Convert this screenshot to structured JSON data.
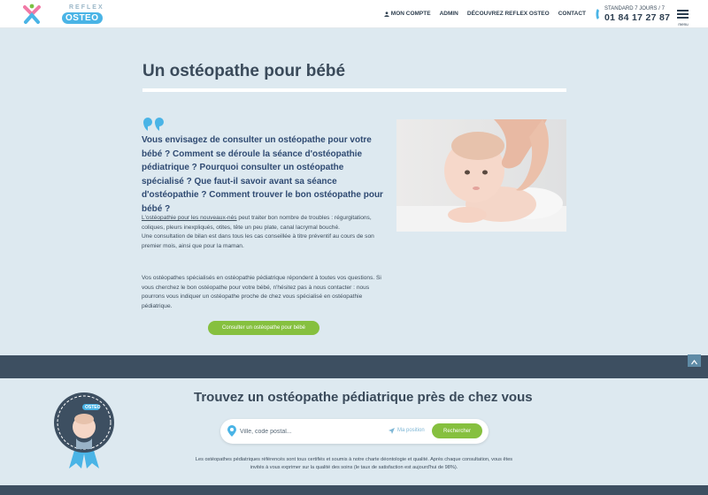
{
  "header": {
    "logo_small": "REFLEX",
    "logo_big": "OSTEO",
    "nav": [
      {
        "label": "MON COMPTE",
        "icon": "user-icon"
      },
      {
        "label": "ADMIN"
      },
      {
        "label": "DÉCOUVREZ REFLEX OSTEO"
      },
      {
        "label": "CONTACT"
      }
    ],
    "phone_sub": "STANDARD 7 JOURS / 7",
    "phone_number": "01 84 17 27 87",
    "menu_label": "menu"
  },
  "main": {
    "title": "Un ostéopathe pour bébé",
    "lead": "Vous envisagez de consulter un ostéopathe pour votre bébé ? Comment se déroule la séance d'ostéopathie pédiatrique ? Pourquoi consulter un ostéopathe spécialisé ? Que faut-il savoir avant sa séance d'ostéopathie ? Comment trouver le bon ostéopathe pour bébé ?",
    "link_text": "L'ostéopathie pour les nouveaux-nés",
    "para1_rest": " peut traiter bon nombre de troubles : régurgitations, coliques, pleurs inexpliqués, otites, tête un peu plate, canal lacrymal bouché.",
    "para1_line2": "Une consultation de bilan est dans tous les cas conseillée à titre préventif au cours de son premier mois, ainsi que pour la maman.",
    "para2": "Vos ostéopathes spécialisés en ostéopathie pédiatrique répondent à toutes vos questions. Si vous cherchez le bon ostéopathe pour votre bébé, n'hésitez pas à nous contacter : nous pourrons vous indiquer un ostéopathe proche de chez vous spécialisé en ostéopathie pédiatrique.",
    "cta_label": "Consulter un ostéopathe pour bébé"
  },
  "finder": {
    "title": "Trouvez un ostéopathe pédiatrique près de chez vous",
    "badge_text": "OSTEO",
    "search_placeholder": "Ville, code postal...",
    "my_position": "Ma position",
    "search_button": "Rechercher",
    "disclaimer": "Les ostéopathes pédiatriques référencés sont tous certifiés et soumis à notre charte déontologie et qualité. Après chaque consultation, vous êtes invités à vous exprimer sur la qualité des soins (le taux de satisfaction est aujourd'hui de 98%)."
  },
  "colors": {
    "accent_green": "#86c03f",
    "accent_blue": "#4ab4e6",
    "band_dark": "#3d4f61",
    "background": "#dde9f0"
  }
}
